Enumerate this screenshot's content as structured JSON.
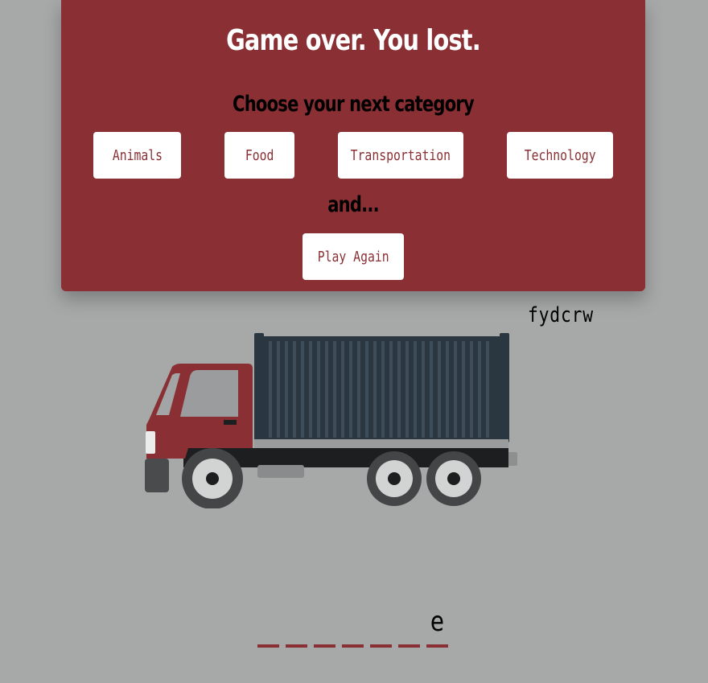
{
  "modal": {
    "title": "Game over. You lost.",
    "subtitle": "Choose your next category",
    "categories": [
      "Animals",
      "Food",
      "Transportation",
      "Technology"
    ],
    "and_text": "and...",
    "play_again_label": "Play Again"
  },
  "guessed_letters": "fydcrw",
  "illustration": "truck",
  "word": {
    "slots": [
      "",
      "",
      "",
      "",
      "",
      "",
      "e"
    ]
  },
  "colors": {
    "accent": "#8a2f33",
    "background": "#a7a8a8"
  }
}
